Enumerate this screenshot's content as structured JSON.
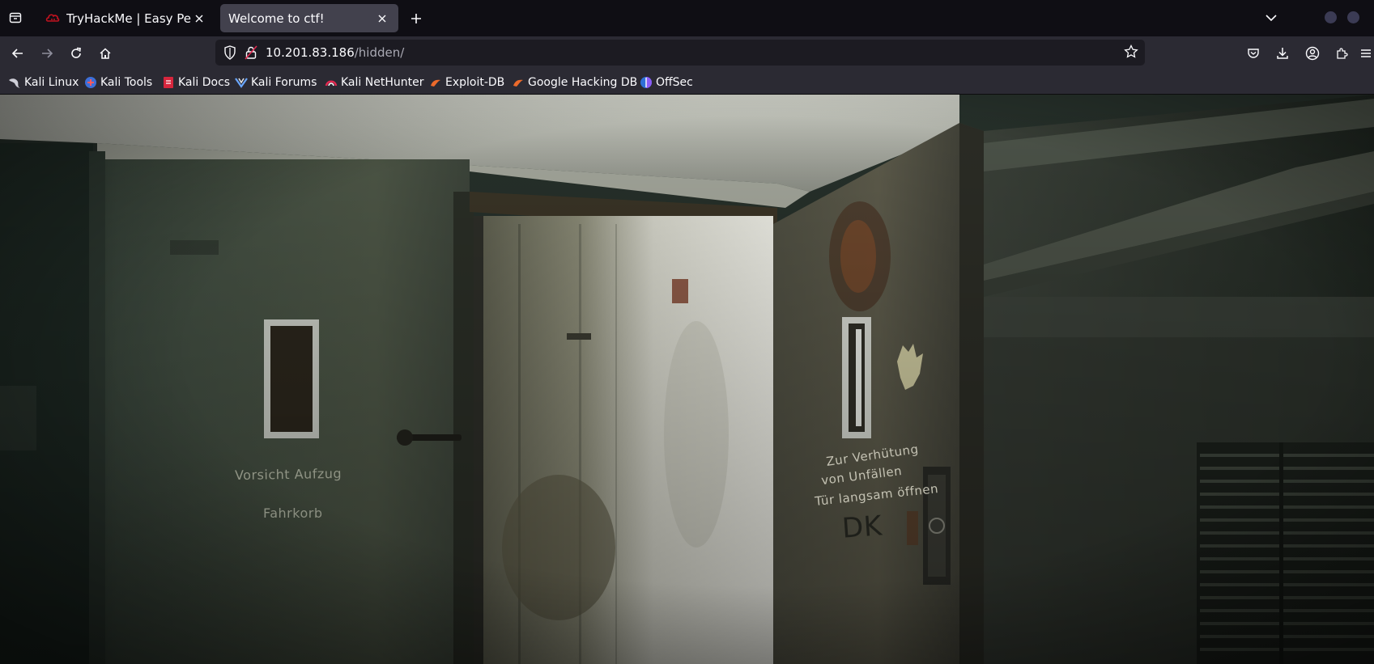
{
  "browser": {
    "tabs": [
      {
        "title": "TryHackMe | Easy Peasy",
        "active": false,
        "favicon": "tryhackme-icon"
      },
      {
        "title": "Welcome to ctf!",
        "active": true,
        "favicon": ""
      }
    ],
    "url": {
      "host": "10.201.83.186",
      "path": "/hidden/"
    },
    "bookmarks": [
      {
        "label": "Kali Linux",
        "icon": "kali-dragon-icon"
      },
      {
        "label": "Kali Tools",
        "icon": "kali-tools-icon"
      },
      {
        "label": "Kali Docs",
        "icon": "kali-docs-icon"
      },
      {
        "label": "Kali Forums",
        "icon": "kali-forums-icon"
      },
      {
        "label": "Kali NetHunter",
        "icon": "nethunter-icon"
      },
      {
        "label": "Exploit-DB",
        "icon": "exploit-db-icon"
      },
      {
        "label": "Google Hacking DB",
        "icon": "ghdb-icon"
      },
      {
        "label": "OffSec",
        "icon": "offsec-icon"
      }
    ]
  },
  "page": {
    "image_description_icon": "abandoned-elevator-image",
    "sign_texts": {
      "left_door_1": "Vorsicht  Aufzug",
      "left_door_2": "Fahrkorb",
      "right_door_1": "Zur Verhütung",
      "right_door_2": "von Unfällen",
      "right_door_3": "Tür langsam öffnen",
      "right_door_4": "DK"
    }
  },
  "colors": {
    "tab_strip": "#0f0e14",
    "toolbar": "#2b2a33",
    "active_tab": "#42414d",
    "urlbar": "#1c1b22"
  }
}
